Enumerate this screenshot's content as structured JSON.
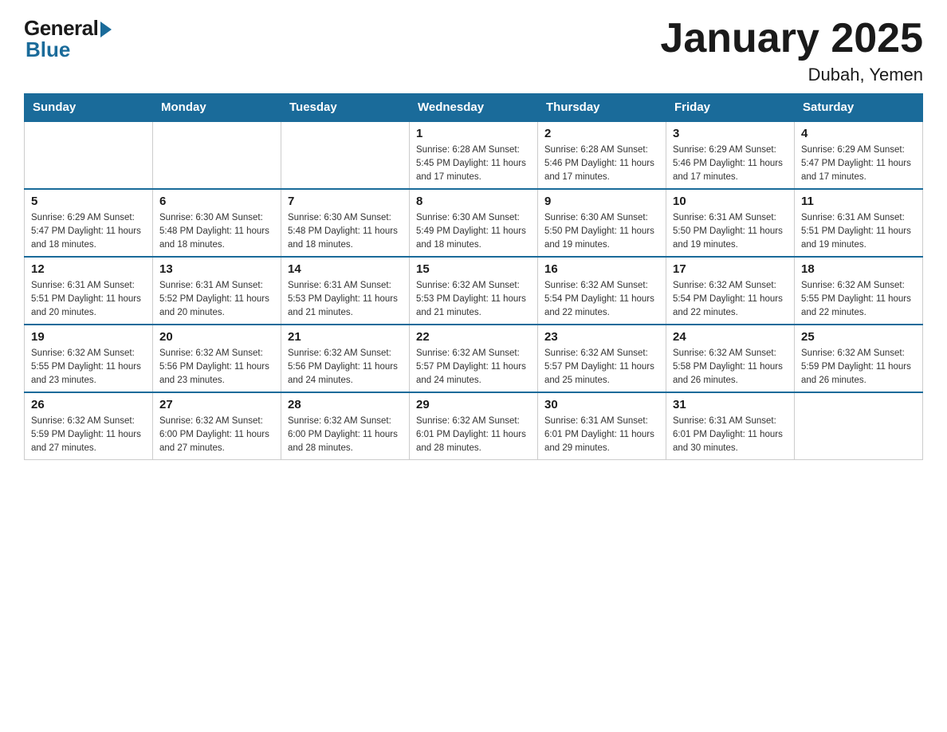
{
  "logo": {
    "general": "General",
    "blue": "Blue"
  },
  "title": "January 2025",
  "location": "Dubah, Yemen",
  "days_of_week": [
    "Sunday",
    "Monday",
    "Tuesday",
    "Wednesday",
    "Thursday",
    "Friday",
    "Saturday"
  ],
  "weeks": [
    [
      {
        "day": "",
        "info": ""
      },
      {
        "day": "",
        "info": ""
      },
      {
        "day": "",
        "info": ""
      },
      {
        "day": "1",
        "info": "Sunrise: 6:28 AM\nSunset: 5:45 PM\nDaylight: 11 hours\nand 17 minutes."
      },
      {
        "day": "2",
        "info": "Sunrise: 6:28 AM\nSunset: 5:46 PM\nDaylight: 11 hours\nand 17 minutes."
      },
      {
        "day": "3",
        "info": "Sunrise: 6:29 AM\nSunset: 5:46 PM\nDaylight: 11 hours\nand 17 minutes."
      },
      {
        "day": "4",
        "info": "Sunrise: 6:29 AM\nSunset: 5:47 PM\nDaylight: 11 hours\nand 17 minutes."
      }
    ],
    [
      {
        "day": "5",
        "info": "Sunrise: 6:29 AM\nSunset: 5:47 PM\nDaylight: 11 hours\nand 18 minutes."
      },
      {
        "day": "6",
        "info": "Sunrise: 6:30 AM\nSunset: 5:48 PM\nDaylight: 11 hours\nand 18 minutes."
      },
      {
        "day": "7",
        "info": "Sunrise: 6:30 AM\nSunset: 5:48 PM\nDaylight: 11 hours\nand 18 minutes."
      },
      {
        "day": "8",
        "info": "Sunrise: 6:30 AM\nSunset: 5:49 PM\nDaylight: 11 hours\nand 18 minutes."
      },
      {
        "day": "9",
        "info": "Sunrise: 6:30 AM\nSunset: 5:50 PM\nDaylight: 11 hours\nand 19 minutes."
      },
      {
        "day": "10",
        "info": "Sunrise: 6:31 AM\nSunset: 5:50 PM\nDaylight: 11 hours\nand 19 minutes."
      },
      {
        "day": "11",
        "info": "Sunrise: 6:31 AM\nSunset: 5:51 PM\nDaylight: 11 hours\nand 19 minutes."
      }
    ],
    [
      {
        "day": "12",
        "info": "Sunrise: 6:31 AM\nSunset: 5:51 PM\nDaylight: 11 hours\nand 20 minutes."
      },
      {
        "day": "13",
        "info": "Sunrise: 6:31 AM\nSunset: 5:52 PM\nDaylight: 11 hours\nand 20 minutes."
      },
      {
        "day": "14",
        "info": "Sunrise: 6:31 AM\nSunset: 5:53 PM\nDaylight: 11 hours\nand 21 minutes."
      },
      {
        "day": "15",
        "info": "Sunrise: 6:32 AM\nSunset: 5:53 PM\nDaylight: 11 hours\nand 21 minutes."
      },
      {
        "day": "16",
        "info": "Sunrise: 6:32 AM\nSunset: 5:54 PM\nDaylight: 11 hours\nand 22 minutes."
      },
      {
        "day": "17",
        "info": "Sunrise: 6:32 AM\nSunset: 5:54 PM\nDaylight: 11 hours\nand 22 minutes."
      },
      {
        "day": "18",
        "info": "Sunrise: 6:32 AM\nSunset: 5:55 PM\nDaylight: 11 hours\nand 22 minutes."
      }
    ],
    [
      {
        "day": "19",
        "info": "Sunrise: 6:32 AM\nSunset: 5:55 PM\nDaylight: 11 hours\nand 23 minutes."
      },
      {
        "day": "20",
        "info": "Sunrise: 6:32 AM\nSunset: 5:56 PM\nDaylight: 11 hours\nand 23 minutes."
      },
      {
        "day": "21",
        "info": "Sunrise: 6:32 AM\nSunset: 5:56 PM\nDaylight: 11 hours\nand 24 minutes."
      },
      {
        "day": "22",
        "info": "Sunrise: 6:32 AM\nSunset: 5:57 PM\nDaylight: 11 hours\nand 24 minutes."
      },
      {
        "day": "23",
        "info": "Sunrise: 6:32 AM\nSunset: 5:57 PM\nDaylight: 11 hours\nand 25 minutes."
      },
      {
        "day": "24",
        "info": "Sunrise: 6:32 AM\nSunset: 5:58 PM\nDaylight: 11 hours\nand 26 minutes."
      },
      {
        "day": "25",
        "info": "Sunrise: 6:32 AM\nSunset: 5:59 PM\nDaylight: 11 hours\nand 26 minutes."
      }
    ],
    [
      {
        "day": "26",
        "info": "Sunrise: 6:32 AM\nSunset: 5:59 PM\nDaylight: 11 hours\nand 27 minutes."
      },
      {
        "day": "27",
        "info": "Sunrise: 6:32 AM\nSunset: 6:00 PM\nDaylight: 11 hours\nand 27 minutes."
      },
      {
        "day": "28",
        "info": "Sunrise: 6:32 AM\nSunset: 6:00 PM\nDaylight: 11 hours\nand 28 minutes."
      },
      {
        "day": "29",
        "info": "Sunrise: 6:32 AM\nSunset: 6:01 PM\nDaylight: 11 hours\nand 28 minutes."
      },
      {
        "day": "30",
        "info": "Sunrise: 6:31 AM\nSunset: 6:01 PM\nDaylight: 11 hours\nand 29 minutes."
      },
      {
        "day": "31",
        "info": "Sunrise: 6:31 AM\nSunset: 6:01 PM\nDaylight: 11 hours\nand 30 minutes."
      },
      {
        "day": "",
        "info": ""
      }
    ]
  ]
}
